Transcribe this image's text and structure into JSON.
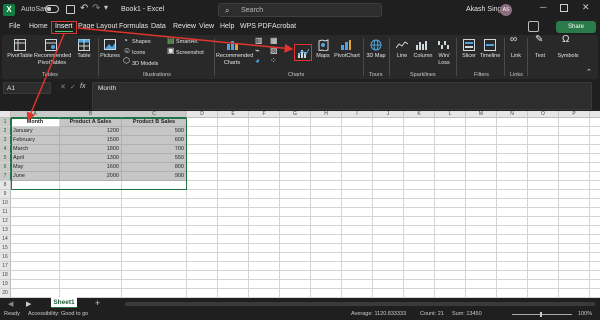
{
  "app": {
    "autosave_label": "AutoSave",
    "doc_title": "Book1 - Excel",
    "search_placeholder": "Search",
    "user_name": "Akash Singh",
    "user_initials": "AS",
    "share_label": "Share"
  },
  "menu": {
    "tabs": [
      "File",
      "Home",
      "Insert",
      "Page Layout",
      "Formulas",
      "Data",
      "Review",
      "View",
      "Help",
      "WPS PDF",
      "Acrobat"
    ]
  },
  "ribbon": {
    "items": {
      "pivottable": "PivotTable",
      "rec_pivot": "Recommended PivotTables",
      "table": "Table",
      "pictures": "Pictures",
      "shapes": "Shapes",
      "icons": "Icons",
      "models": "3D Models",
      "smartart": "SmartArt",
      "screenshot": "Screenshot",
      "rec_charts": "Recommended Charts",
      "maps": "Maps",
      "pivotchart": "PivotChart",
      "map3d": "3D Map",
      "line": "Line",
      "column": "Column",
      "winloss": "Win/ Loss",
      "slicer": "Slicer",
      "timeline": "Timeline",
      "link": "Link",
      "text": "Text",
      "symbols": "Symbols"
    },
    "groups": {
      "tables": "Tables",
      "illustrations": "Illustrations",
      "charts": "Charts",
      "tours": "Tours",
      "sparklines": "Sparklines",
      "filters": "Filters",
      "links": "Links"
    }
  },
  "formula_bar": {
    "name_box": "A1",
    "content": "Month"
  },
  "sheet": {
    "columns": [
      "A",
      "B",
      "C",
      "D",
      "E",
      "F",
      "G",
      "H",
      "I",
      "J",
      "K",
      "L",
      "M",
      "N",
      "O",
      "P",
      "Q"
    ],
    "rows": [
      "1",
      "2",
      "3",
      "4",
      "5",
      "6",
      "7",
      "8",
      "9",
      "10",
      "11",
      "12",
      "13",
      "14",
      "15",
      "16",
      "17",
      "18",
      "19",
      "20",
      "21"
    ],
    "headers": [
      "Month",
      "Product A Sales",
      "Product B Sales"
    ],
    "data": [
      [
        "January",
        "1200",
        "500"
      ],
      [
        "February",
        "1500",
        "600"
      ],
      [
        "March",
        "1800",
        "700"
      ],
      [
        "April",
        "1300",
        "550"
      ],
      [
        "May",
        "1600",
        "800"
      ],
      [
        "June",
        "2000",
        "900"
      ]
    ],
    "tab_name": "Sheet1"
  },
  "status": {
    "ready": "Ready",
    "accessibility": "Accessibility: Good to go",
    "average": "Average: 1120.833333",
    "count": "Count: 21",
    "sum": "Sum: 13450",
    "zoom": "100%"
  },
  "colors": {
    "accent": "#217346",
    "annotation": "#e0342e"
  }
}
